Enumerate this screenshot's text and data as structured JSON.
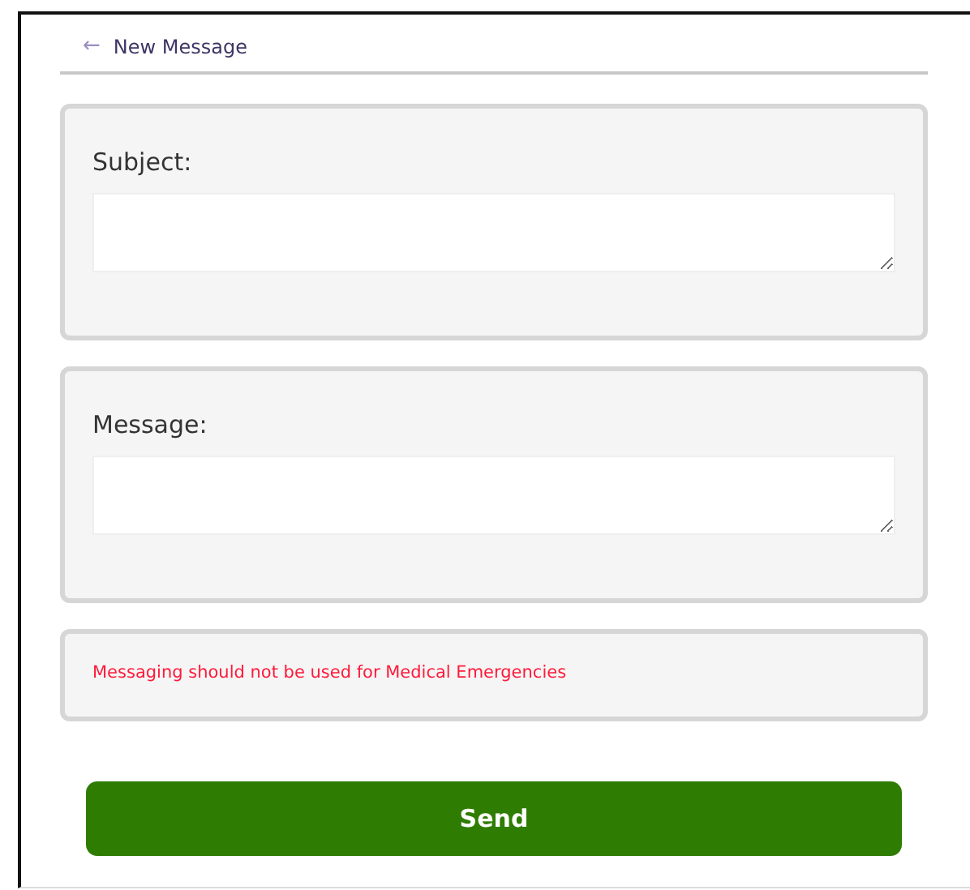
{
  "header": {
    "back_icon": "←",
    "title": "New Message"
  },
  "fields": [
    {
      "label": "Subject:"
    },
    {
      "label": "Message:"
    }
  ],
  "notice": "Messaging should not be used for Medical Emergencies",
  "send_button": "Send"
}
